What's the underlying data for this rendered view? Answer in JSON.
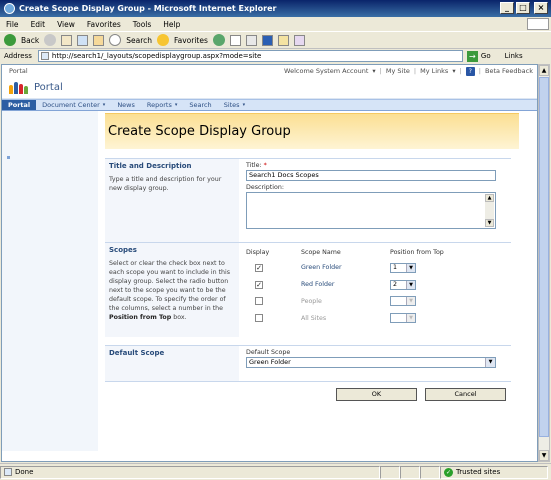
{
  "window": {
    "title": "Create Scope Display Group - Microsoft Internet Explorer",
    "controls": {
      "minimize": "_",
      "maximize": "□",
      "close": "×"
    }
  },
  "menubar": {
    "items": [
      "File",
      "Edit",
      "View",
      "Favorites",
      "Tools",
      "Help"
    ]
  },
  "toolbar": {
    "back": "Back",
    "search": "Search",
    "favorites": "Favorites"
  },
  "addressbar": {
    "label": "Address",
    "url": "http://search1/_layouts/scopedisplaygroup.aspx?mode=site",
    "go": "Go",
    "links": "Links"
  },
  "sharepoint": {
    "breadcrumb": "Portal",
    "welcome": "Welcome System Account",
    "my_site": "My Site",
    "my_links": "My Links",
    "help": "?",
    "beta_feedback": "Beta Feedback",
    "site_name": "Portal",
    "nav": [
      "Portal",
      "Document Center",
      "News",
      "Reports",
      "Search",
      "Sites"
    ],
    "nav_dropdown_arrow": "▾"
  },
  "page": {
    "title": "Create Scope Display Group",
    "title_section": {
      "heading": "Title and Description",
      "description": "Type a title and description for your new display group.",
      "title_label": "Title:",
      "required_mark": "*",
      "title_value": "Search1 Docs Scopes",
      "description_label": "Description:"
    },
    "scopes_section": {
      "heading": "Scopes",
      "description": "Select or clear the check box next to each scope you want to include in this display group. Select the radio button next to the scope you want to be the default scope. To specify the order of the columns, select a number in the",
      "description_bold": "Position from Top",
      "description_end": "box.",
      "columns": {
        "display": "Display",
        "scope_name": "Scope Name",
        "position": "Position from Top"
      },
      "rows": [
        {
          "checked": "✓",
          "name": "Green Folder",
          "position": "1"
        },
        {
          "checked": "✓",
          "name": "Red Folder",
          "position": "2"
        },
        {
          "checked": "",
          "name": "People",
          "position": ""
        },
        {
          "checked": "",
          "name": "All Sites",
          "position": ""
        }
      ]
    },
    "default_scope_section": {
      "heading": "Default Scope",
      "label": "Default Scope",
      "value": "Green Folder"
    },
    "buttons": {
      "ok": "OK",
      "cancel": "Cancel"
    }
  },
  "statusbar": {
    "status": "Done",
    "zone": "Trusted sites"
  }
}
